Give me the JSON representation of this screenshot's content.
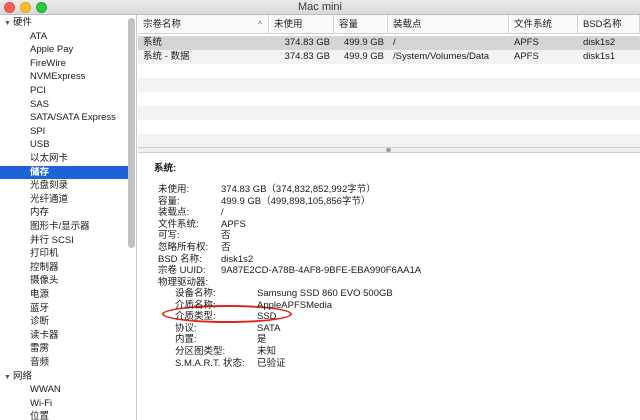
{
  "window": {
    "title": "Mac mini"
  },
  "colors": {
    "selection": "#1b63d6",
    "annotation": "#e4231b"
  },
  "sidebar": {
    "rows": [
      {
        "type": "group",
        "label": "硬件",
        "expanded": true
      },
      {
        "type": "item",
        "label": "ATA"
      },
      {
        "type": "item",
        "label": "Apple Pay"
      },
      {
        "type": "item",
        "label": "FireWire"
      },
      {
        "type": "item",
        "label": "NVMExpress"
      },
      {
        "type": "item",
        "label": "PCI"
      },
      {
        "type": "item",
        "label": "SAS"
      },
      {
        "type": "item",
        "label": "SATA/SATA Express"
      },
      {
        "type": "item",
        "label": "SPI"
      },
      {
        "type": "item",
        "label": "USB"
      },
      {
        "type": "item",
        "label": "以太网卡"
      },
      {
        "type": "item",
        "label": "储存",
        "selected": true
      },
      {
        "type": "item",
        "label": "光盘刻录"
      },
      {
        "type": "item",
        "label": "光纤通道"
      },
      {
        "type": "item",
        "label": "内存"
      },
      {
        "type": "item",
        "label": "图形卡/显示器"
      },
      {
        "type": "item",
        "label": "并行 SCSI"
      },
      {
        "type": "item",
        "label": "打印机"
      },
      {
        "type": "item",
        "label": "控制器"
      },
      {
        "type": "item",
        "label": "摄像头"
      },
      {
        "type": "item",
        "label": "电源"
      },
      {
        "type": "item",
        "label": "蓝牙"
      },
      {
        "type": "item",
        "label": "诊断"
      },
      {
        "type": "item",
        "label": "读卡器"
      },
      {
        "type": "item",
        "label": "雷雳"
      },
      {
        "type": "item",
        "label": "音频"
      },
      {
        "type": "group",
        "label": "网络",
        "expanded": true
      },
      {
        "type": "item",
        "label": "WWAN"
      },
      {
        "type": "item",
        "label": "Wi-Fi"
      },
      {
        "type": "item",
        "label": "位置"
      }
    ]
  },
  "table": {
    "columns": [
      "宗卷名称",
      "未使用",
      "容量",
      "装载点",
      "文件系统",
      "BSD名称"
    ],
    "sort_indicator": "^",
    "rows": [
      [
        "系统",
        "374.83 GB",
        "499.9 GB",
        "/",
        "APFS",
        "disk1s2"
      ],
      [
        "系统 - 数据",
        "374.83 GB",
        "499.9 GB",
        "/System/Volumes/Data",
        "APFS",
        "disk1s1"
      ]
    ]
  },
  "detail": {
    "title": "系统:",
    "fields": [
      {
        "key": "未使用:",
        "value": "374.83 GB（374,832,852,992字节）"
      },
      {
        "key": "容量:",
        "value": "499.9 GB（499,898,105,856字节）"
      },
      {
        "key": "装载点:",
        "value": "/"
      },
      {
        "key": "文件系统:",
        "value": "APFS"
      },
      {
        "key": "可写:",
        "value": "否"
      },
      {
        "key": "忽略所有权:",
        "value": "否"
      },
      {
        "key": "BSD 名称:",
        "value": "disk1s2"
      },
      {
        "key": "宗卷 UUID:",
        "value": "9A87E2CD-A78B-4AF8-9BFE-EBA990F6AA1A"
      },
      {
        "key": "物理驱动器:",
        "value": ""
      }
    ],
    "drive_fields": [
      {
        "key": "设备名称:",
        "value": "Samsung SSD 860 EVO 500GB"
      },
      {
        "key": "介质名称:",
        "value": "AppleAPFSMedia"
      },
      {
        "key": "介质类型:",
        "value": "SSD",
        "highlighted": true
      },
      {
        "key": "协议:",
        "value": "SATA"
      },
      {
        "key": "内置:",
        "value": "是"
      },
      {
        "key": "分区图类型:",
        "value": "未知"
      },
      {
        "key": "S.M.A.R.T. 状态:",
        "value": "已验证"
      }
    ]
  }
}
